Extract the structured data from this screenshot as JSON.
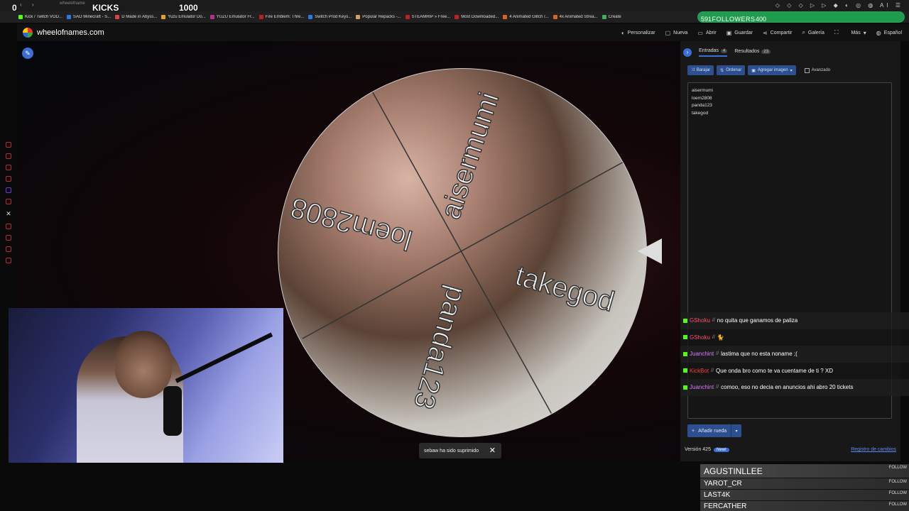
{
  "browser": {
    "url": "wheelofname",
    "bookmarks": [
      {
        "label": "Kick / Twitch VOD...",
        "color": "#53fc18"
      },
      {
        "label": "SAO Minecraft - S...",
        "color": "#2a7ae4"
      },
      {
        "label": "D Made in Abyss...",
        "color": "#e04040"
      },
      {
        "label": "Yuzu Emulator Do...",
        "color": "#e8a020"
      },
      {
        "label": "YUZU Emulator Fr...",
        "color": "#b03090"
      },
      {
        "label": "Fire Emblem: Thre...",
        "color": "#c02020"
      },
      {
        "label": "Switch Prod Keys...",
        "color": "#2a7ae4"
      },
      {
        "label": "Popular Repacks -...",
        "color": "#d0a060"
      },
      {
        "label": "STEAMRIP » Free...",
        "color": "#c02020"
      },
      {
        "label": "Most Downloaded...",
        "color": "#c02020"
      },
      {
        "label": "4 Animated Glitch /...",
        "color": "#e06020"
      },
      {
        "label": "4x Animated Strea...",
        "color": "#e06020"
      },
      {
        "label": "Create",
        "color": "#40b060"
      }
    ]
  },
  "overlay": {
    "left_count": "0",
    "kicks_label": "KICKS",
    "kicks_goal": "1000",
    "followers": {
      "current": "591",
      "label": "FOLLOWERS",
      "goal": "400",
      "progress": 1.0
    }
  },
  "app": {
    "site_name": "wheelofnames.com",
    "menu": [
      {
        "label": "Personalizar",
        "icon": "palette-icon",
        "glyph": "◐"
      },
      {
        "label": "Nueva",
        "icon": "new-file-icon",
        "glyph": "▢"
      },
      {
        "label": "Abrir",
        "icon": "folder-icon",
        "glyph": "▭"
      },
      {
        "label": "Guardar",
        "icon": "save-icon",
        "glyph": "▣"
      },
      {
        "label": "Compartir",
        "icon": "share-icon",
        "glyph": "⋖"
      },
      {
        "label": "Galería",
        "icon": "search-icon",
        "glyph": "⌕"
      },
      {
        "label": "",
        "icon": "fullscreen-icon",
        "glyph": "⛶"
      },
      {
        "label": "Más",
        "icon": "chevron-down-icon",
        "glyph": "▾"
      },
      {
        "label": "Español",
        "icon": "globe-icon",
        "glyph": "◍"
      }
    ]
  },
  "wheel": {
    "entries": [
      "aisermumi",
      "takegod",
      "panda123",
      "loem2808"
    ],
    "toast": "sebaw ha sido suprimido"
  },
  "panel": {
    "tabs": [
      {
        "label": "Entradas",
        "count": "4",
        "active": true
      },
      {
        "label": "Resultados",
        "count": "23",
        "active": false
      }
    ],
    "tools": {
      "shuffle": "Barajar",
      "sort": "Ordenar",
      "add_image": "Agregar imagen",
      "advanced": "Avanzado"
    },
    "entries": [
      "aisermumi",
      "loem2808",
      "panda123",
      "takegod"
    ],
    "add_wheel": "Añadir rueda",
    "version": "Versión 425",
    "new_badge": "New!",
    "changelog": "Registro de cambios"
  },
  "chat": [
    {
      "user": "GShoku",
      "color": "#ff4d6d",
      "message": "no quita que ganamos de paliza"
    },
    {
      "user": "GShoku",
      "color": "#ff4d6d",
      "message": "🐈"
    },
    {
      "user": "Juanchint",
      "color": "#d97bff",
      "message": "lastima que no esta noname ;("
    },
    {
      "user": "KickBot",
      "color": "#ff3b3b",
      "message": "Que onda bro como te va cuentame de ti ? XD"
    },
    {
      "user": "Juanchint",
      "color": "#d97bff",
      "message": "comoo, eso no decia en anuncios ahi abro 20 tickets"
    }
  ],
  "follow_list": {
    "tag": "FOLLOW",
    "names": [
      "AGUSTINLLEE",
      "YAROT_CR",
      "LAST4K",
      "FERCATHER"
    ]
  }
}
